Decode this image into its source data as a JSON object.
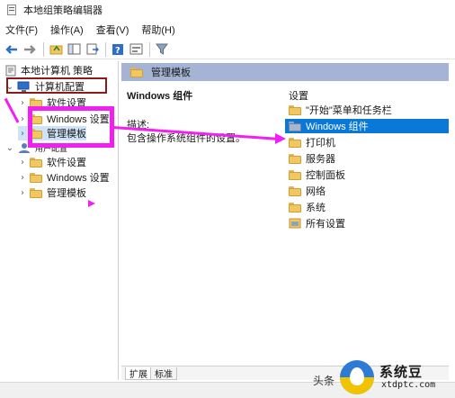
{
  "window": {
    "title": "本地组策略编辑器"
  },
  "menu": [
    "文件(F)",
    "操作(A)",
    "查看(V)",
    "帮助(H)"
  ],
  "toolbar": {
    "buttons": [
      "back-icon",
      "forward-icon",
      "up-folder-icon",
      "show-hide-tree-icon",
      "export-list-icon",
      "help-icon",
      "properties-icon",
      "filter-icon"
    ]
  },
  "tree": {
    "root": "本地计算机 策略",
    "computer_config": "计算机配置",
    "computer_children": [
      "软件设置",
      "Windows 设置",
      "管理模板"
    ],
    "user_config": "用户配置",
    "user_children": [
      "软件设置",
      "Windows 设置",
      "管理模板"
    ]
  },
  "content": {
    "header": "管理模板",
    "desc_title": "Windows 组件",
    "desc_label": "描述:",
    "desc_text": "包含操作系统组件的设置。",
    "settings_header": "设置",
    "settings": [
      {
        "label": "\"开始\"菜单和任务栏",
        "icon": "folder-icon"
      },
      {
        "label": "Windows 组件",
        "icon": "folder-icon",
        "selected": true
      },
      {
        "label": "打印机",
        "icon": "folder-icon"
      },
      {
        "label": "服务器",
        "icon": "folder-icon"
      },
      {
        "label": "控制面板",
        "icon": "folder-icon"
      },
      {
        "label": "网络",
        "icon": "folder-icon"
      },
      {
        "label": "系统",
        "icon": "folder-icon"
      },
      {
        "label": "所有设置",
        "icon": "settings-icon"
      }
    ]
  },
  "tabs": [
    "扩展",
    "标准"
  ],
  "watermark": {
    "prefix": "头条",
    "name": "系统豆",
    "url": "xtdptc.com"
  },
  "colors": {
    "header_bg": "#a5b4d4",
    "selected_bg": "#0a78d7",
    "annotation": "#f21ff2",
    "annotation_box": "#8b1a1a"
  }
}
